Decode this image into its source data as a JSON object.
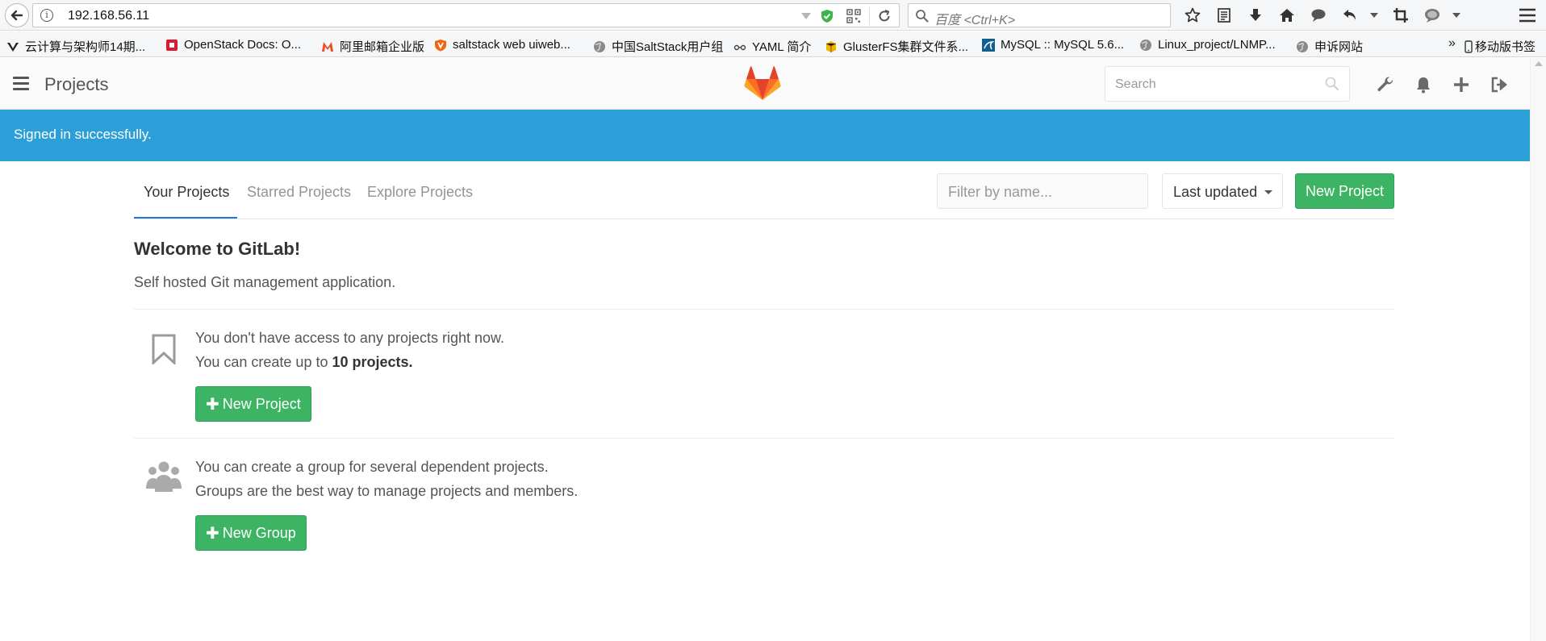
{
  "browser": {
    "url": "192.168.56.11",
    "search_placeholder": "百度 <Ctrl+K>",
    "toolbar_icons": [
      "star-icon",
      "reader-icon",
      "download-icon",
      "home-icon",
      "chat-icon",
      "undo-icon",
      "crop-icon",
      "mask-icon",
      "menu-icon"
    ],
    "bookmarks": [
      {
        "label": "云计算与架构师14期...",
        "icon": "v-logo-icon"
      },
      {
        "label": "OpenStack Docs: O...",
        "icon": "openstack-icon"
      },
      {
        "label": "阿里邮箱企业版",
        "icon": "mail-m-icon"
      },
      {
        "label": "saltstack web uiweb...",
        "icon": "shield-logo-icon"
      },
      {
        "label": "中国SaltStack用户组",
        "icon": "globe-icon"
      },
      {
        "label": "YAML 简介",
        "icon": "yaml-icon"
      },
      {
        "label": "GlusterFS集群文件系...",
        "icon": "box-icon"
      },
      {
        "label": "MySQL :: MySQL 5.6...",
        "icon": "mysql-icon"
      },
      {
        "label": "Linux_project/LNMP...",
        "icon": "globe-icon"
      },
      {
        "label": "申诉网站",
        "icon": "globe-icon"
      }
    ],
    "more_label": "»",
    "mobile_bookmarks": "移动版书签"
  },
  "header": {
    "title": "Projects",
    "search_placeholder": "Search"
  },
  "flash": {
    "message": "Signed in successfully."
  },
  "tabs": [
    {
      "label": "Your Projects",
      "active": true
    },
    {
      "label": "Starred Projects",
      "active": false
    },
    {
      "label": "Explore Projects",
      "active": false
    }
  ],
  "filter": {
    "placeholder": "Filter by name...",
    "sort_label": "Last updated",
    "new_project_label": "New Project"
  },
  "welcome": {
    "title": "Welcome to GitLab!",
    "subtitle": "Self hosted Git management application."
  },
  "projects_block": {
    "line1": "You don't have access to any projects right now.",
    "line2_prefix": "You can create up to ",
    "line2_bold": "10 projects.",
    "button_label": "New Project"
  },
  "groups_block": {
    "line1": "You can create a group for several dependent projects.",
    "line2": "Groups are the best way to manage projects and members.",
    "button_label": "New Group"
  },
  "colors": {
    "flash_bg": "#2d9fd8",
    "success_green": "#3cb464",
    "tab_active_underline": "#1f78d1"
  }
}
